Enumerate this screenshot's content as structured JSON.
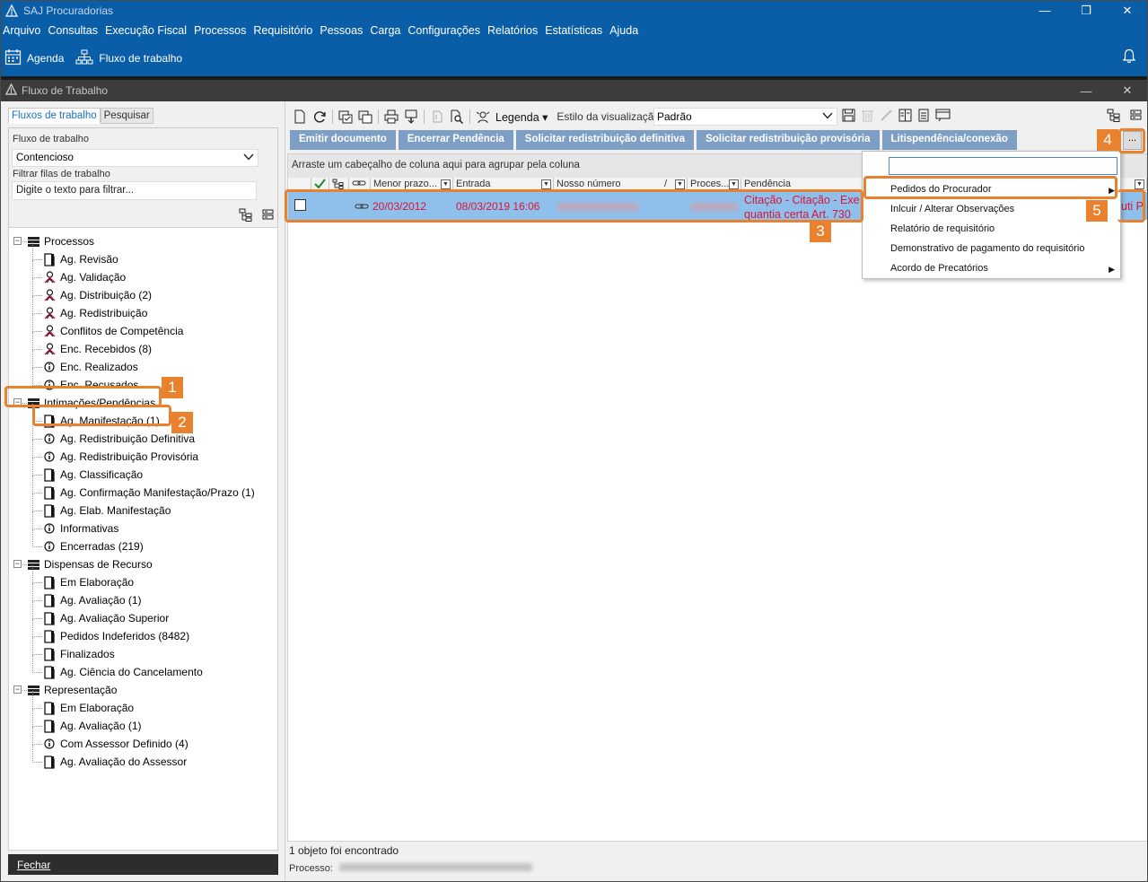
{
  "app": {
    "title": "SAJ Procuradorias",
    "menu": [
      "Arquivo",
      "Consultas",
      "Execução Fiscal",
      "Processos",
      "Requisitório",
      "Pessoas",
      "Carga",
      "Configurações",
      "Relatórios",
      "Estatísticas",
      "Ajuda"
    ],
    "shortcuts": [
      {
        "label": "Agenda",
        "icon": "calendar-icon"
      },
      {
        "label": "Fluxo de trabalho",
        "icon": "org-chart-icon"
      }
    ],
    "window_buttons": {
      "minimize": "—",
      "restore": "❐",
      "close": "✕"
    }
  },
  "window": {
    "title": "Fluxo de Trabalho",
    "buttons": {
      "minimize": "—",
      "close": "✕"
    }
  },
  "left": {
    "tabs": [
      "Fluxos de trabalho",
      "Pesquisar"
    ],
    "fluxo_label": "Fluxo de trabalho",
    "fluxo_value": "Contencioso",
    "filter_label": "Filtrar filas de trabalho",
    "filter_placeholder": "Digite o texto para filtrar...",
    "fechar_label": "Fechar",
    "tree": [
      {
        "label": "Processos",
        "level": 0,
        "icon": "list-icon"
      },
      {
        "label": "Ag. Revisão",
        "level": 1,
        "icon": "document-icon"
      },
      {
        "label": "Ag. Validação",
        "level": 1,
        "icon": "person-icon"
      },
      {
        "label": "Ag. Distribuição (2)",
        "level": 1,
        "icon": "person-icon"
      },
      {
        "label": "Ag. Redistribuição",
        "level": 1,
        "icon": "person-icon"
      },
      {
        "label": "Conflitos de Competência",
        "level": 1,
        "icon": "person-icon"
      },
      {
        "label": "Enc. Recebidos (8)",
        "level": 1,
        "icon": "person-icon"
      },
      {
        "label": "Enc. Realizados",
        "level": 1,
        "icon": "info-icon"
      },
      {
        "label": "Enc. Recusados",
        "level": 1,
        "icon": "info-icon"
      },
      {
        "label": "Intimações/Pendências",
        "level": 0,
        "icon": "list-icon"
      },
      {
        "label": "Ag. Manifestação (1)",
        "level": 1,
        "icon": "document-icon"
      },
      {
        "label": "Ag. Redistribuição Definitiva",
        "level": 1,
        "icon": "info-icon"
      },
      {
        "label": "Ag. Redistribuição Provisória",
        "level": 1,
        "icon": "info-icon"
      },
      {
        "label": "Ag. Classificação",
        "level": 1,
        "icon": "document-icon"
      },
      {
        "label": "Ag. Confirmação Manifestação/Prazo (1)",
        "level": 1,
        "icon": "document-icon"
      },
      {
        "label": "Ag. Elab. Manifestação",
        "level": 1,
        "icon": "document-icon"
      },
      {
        "label": "Informativas",
        "level": 1,
        "icon": "info-icon"
      },
      {
        "label": "Encerradas (219)",
        "level": 1,
        "icon": "info-icon"
      },
      {
        "label": "Dispensas de Recurso",
        "level": 0,
        "icon": "list-icon"
      },
      {
        "label": "Em Elaboração",
        "level": 1,
        "icon": "document-icon"
      },
      {
        "label": "Ag. Avaliação (1)",
        "level": 1,
        "icon": "document-icon"
      },
      {
        "label": "Ag. Avaliação Superior",
        "level": 1,
        "icon": "document-icon"
      },
      {
        "label": "Pedidos Indeferidos (8482)",
        "level": 1,
        "icon": "document-icon"
      },
      {
        "label": "Finalizados",
        "level": 1,
        "icon": "document-icon"
      },
      {
        "label": "Ag. Ciência do Cancelamento",
        "level": 1,
        "icon": "document-icon"
      },
      {
        "label": "Representação",
        "level": 0,
        "icon": "list-icon"
      },
      {
        "label": "Em Elaboração",
        "level": 1,
        "icon": "document-icon"
      },
      {
        "label": "Ag. Avaliação (1)",
        "level": 1,
        "icon": "document-icon"
      },
      {
        "label": "Com Assessor Definido (4)",
        "level": 1,
        "icon": "info-icon"
      },
      {
        "label": "Ag. Avaliação do Assessor",
        "level": 1,
        "icon": "document-icon"
      }
    ]
  },
  "toolbar": {
    "legenda": "Legenda",
    "estilo_label": "Estilo da visualização",
    "estilo_value": "Padrão"
  },
  "actions": [
    "Emitir documento",
    "Encerrar Pendência",
    "Solicitar redistribuição definitiva",
    "Solicitar redistribuição provisória",
    "Litispendência/conexão"
  ],
  "more_button": "...",
  "grid": {
    "group_hint": "Arraste um cabeçalho de coluna aqui para agrupar pela coluna",
    "columns": [
      "Menor prazo...",
      "Entrada",
      "Nosso número",
      "Proces...",
      "Pendência"
    ],
    "row": {
      "menor_prazo": "20/03/2012",
      "entrada": "08/03/2019 16:06",
      "pendencia_line1": "Citação - Citação - Exe",
      "pendencia_line2": "quantia certa Art. 730",
      "pendencia_tail": "uti P"
    }
  },
  "status": {
    "count": "1 objeto foi encontrado",
    "processo_label": "Processo:"
  },
  "context_menu": {
    "items": [
      {
        "label": "Pedidos do Procurador",
        "submenu": true
      },
      {
        "label": "Inlcuir / Alterar Observações",
        "submenu": false
      },
      {
        "label": "Relatório de requisitório",
        "submenu": false
      },
      {
        "label": "Demonstrativo de pagamento do requisitório",
        "submenu": false
      },
      {
        "label": "Acordo de Precatórios",
        "submenu": true
      }
    ]
  },
  "callouts": [
    "1",
    "2",
    "3",
    "4",
    "5"
  ],
  "colors": {
    "titlebar": "#0a5ea8",
    "inner_titlebar": "#3c3c3c",
    "action_button": "#7e9fc5",
    "row_selected": "#8fc0eb",
    "row_text": "#d8153a",
    "callout": "#e8822f"
  }
}
